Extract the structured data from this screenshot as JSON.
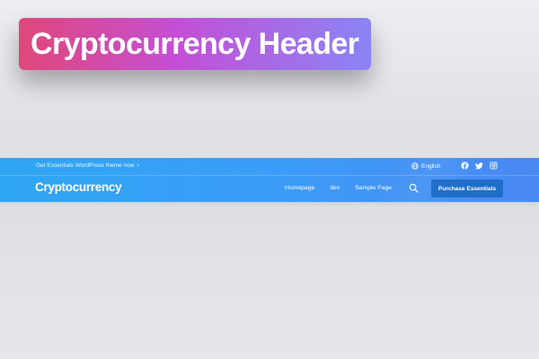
{
  "badge": {
    "title": "Cryptocurrency Header"
  },
  "topbar": {
    "promo_text": "Get Essentials WordPress theme now",
    "promo_arrow": "›",
    "language": "English",
    "socials": [
      "facebook-icon",
      "twitter-icon",
      "instagram-icon"
    ]
  },
  "mainbar": {
    "logo": "Cryptocurrency",
    "nav": [
      "Homepage",
      "dev",
      "Sample Page"
    ],
    "cta_label": "Purchase Essentials"
  },
  "colors": {
    "header_gradient_start": "#2fa6f4",
    "header_gradient_end": "#4a88f2",
    "cta_bg": "#1f6ec9",
    "badge_gradient": [
      "#e0477a",
      "#c44fd6",
      "#8a85f6"
    ]
  }
}
